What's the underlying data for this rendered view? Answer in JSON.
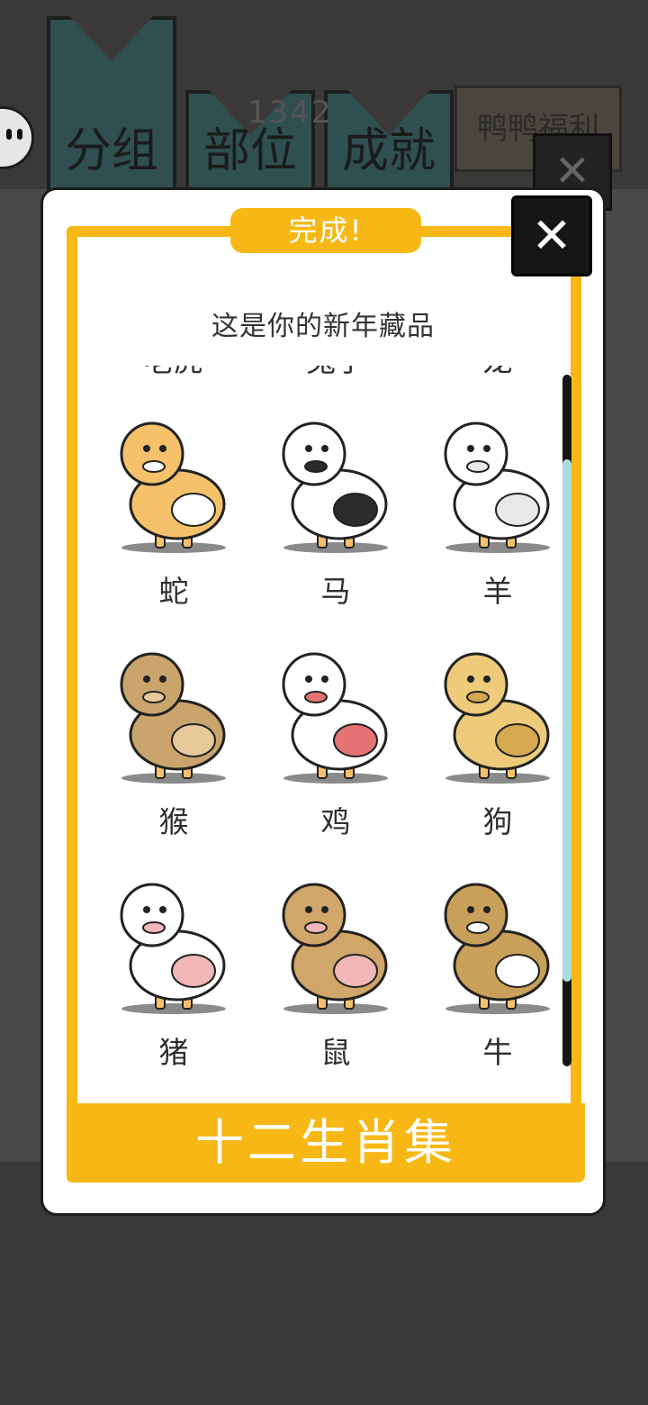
{
  "background": {
    "tabs": [
      "分组",
      "部位",
      "成就"
    ],
    "counter": "1342",
    "promo_link": "鸭鸭福利",
    "close_symbol": "✕"
  },
  "dialog": {
    "badge": "完成!",
    "close_symbol": "✕",
    "subtitle": "这是你的新年藏品",
    "footer": "十二生肖集",
    "scroll_position": 0.15
  },
  "collection": {
    "rows": [
      {
        "items": [
          {
            "label": "老虎",
            "icon": "tiger-icon",
            "body": "#e8a04e",
            "accent": "#8a5a1a"
          },
          {
            "label": "兔子",
            "icon": "rabbit-icon",
            "body": "#ffffff",
            "accent": "#d9d9d9"
          },
          {
            "label": "龙",
            "icon": "dragon-icon",
            "body": "#f0c060",
            "accent": "#e08a8a"
          }
        ]
      },
      {
        "items": [
          {
            "label": "蛇",
            "icon": "snake-icon",
            "body": "#f5c26b",
            "accent": "#ffffff"
          },
          {
            "label": "马",
            "icon": "horse-icon",
            "body": "#ffffff",
            "accent": "#2b2b2b"
          },
          {
            "label": "羊",
            "icon": "sheep-icon",
            "body": "#ffffff",
            "accent": "#e8e8e8"
          }
        ]
      },
      {
        "items": [
          {
            "label": "猴",
            "icon": "monkey-icon",
            "body": "#c9a56d",
            "accent": "#e7c99a"
          },
          {
            "label": "鸡",
            "icon": "rooster-icon",
            "body": "#ffffff",
            "accent": "#e57373"
          },
          {
            "label": "狗",
            "icon": "dog-icon",
            "body": "#eecb7a",
            "accent": "#d6a850"
          }
        ]
      },
      {
        "items": [
          {
            "label": "猪",
            "icon": "pig-icon",
            "body": "#ffffff",
            "accent": "#f2b8b8"
          },
          {
            "label": "鼠",
            "icon": "rat-icon",
            "body": "#d1a66a",
            "accent": "#f2b8b8"
          },
          {
            "label": "牛",
            "icon": "ox-icon",
            "body": "#c9a05a",
            "accent": "#ffffff"
          }
        ]
      }
    ]
  },
  "colors": {
    "accent_yellow": "#f7b815",
    "scroll_thumb": "#a9dcdc"
  }
}
